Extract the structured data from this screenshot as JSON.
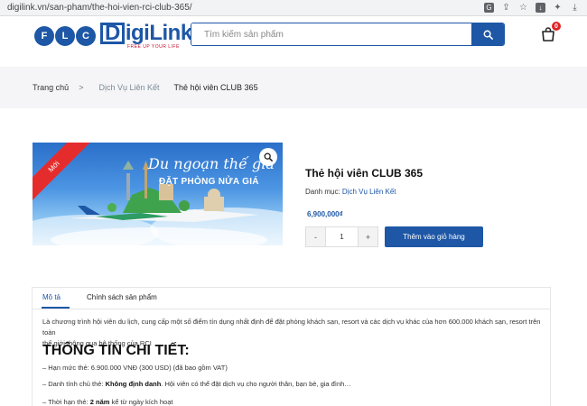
{
  "browser": {
    "url": "digilink.vn/san-pham/the-hoi-vien-rci-club-365/"
  },
  "header": {
    "logo_brand_left": "FLC",
    "logo_brand_right": "DigiLink",
    "logo_tagline": "FREE UP YOUR LIFE",
    "search_placeholder": "Tìm kiếm sản phẩm",
    "cart_count": "0"
  },
  "breadcrumb": {
    "home": "Trang chủ",
    "separator": ">",
    "category": "Dịch Vụ Liên Kết",
    "current": "Thẻ hội viên CLUB 365"
  },
  "product": {
    "badge": "Mới",
    "banner_script": "Du ngoạn thế gia",
    "banner_sub": "ĐẶT PHÒNG NỬA GIÁ",
    "title": "Thẻ hội viên CLUB 365",
    "category_label": "Danh mục:",
    "category_value": "Dịch Vụ Liên Kết",
    "price": "6,900,000₫",
    "qty_minus": "-",
    "qty_value": "1",
    "qty_plus": "+",
    "add_to_cart": "Thêm vào giỏ hàng"
  },
  "tabs": [
    {
      "label": "Mô tả"
    },
    {
      "label": "Chính sách sản phẩm"
    }
  ],
  "description": {
    "intro_line1": "Là chương trình hội viên du lịch, cung cấp một số điểm tín dụng nhất định để đặt phòng khách sạn, resort và các dịch vụ khác của hơn 600.000 khách sạn, resort trên toàn",
    "intro_line2": "thế giới thông qua hệ thống của RCI",
    "heading": "THÔNG TIN CHI TIẾT:",
    "bullet1": "– Hạn mức thẻ: 6.900.000 VNĐ (300 USD) (đã bao gồm VAT)",
    "bullet2_prefix": "– Danh tính chủ thẻ: ",
    "bullet2_bold": "Không định danh",
    "bullet2_suffix": ". Hội viên có thể đặt dịch vụ cho người thân, bạn bè, gia đình…",
    "bullet3_prefix": "– Thời hạn thẻ: ",
    "bullet3_bold": "2 năm",
    "bullet3_suffix": " kể từ ngày kích hoạt"
  },
  "colors": {
    "brand_blue": "#1d57a6",
    "badge_red": "#e52c2c"
  }
}
